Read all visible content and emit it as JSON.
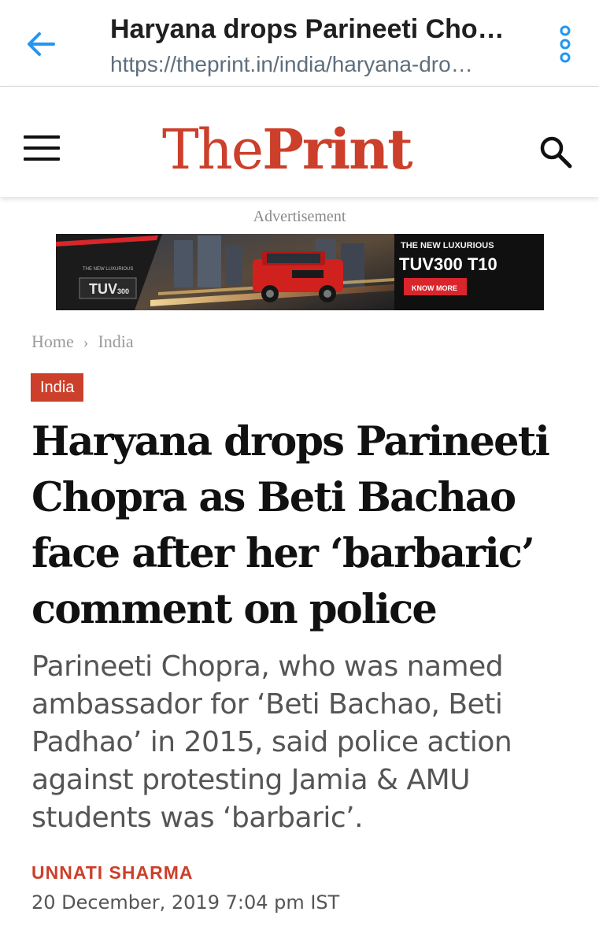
{
  "browser": {
    "title": "Haryana drops Parineeti Cho…",
    "url": "https://theprint.in/india/haryana-dro…",
    "accent_color": "#2196f3"
  },
  "site": {
    "logo_the": "The",
    "logo_print": "Print",
    "brand_color": "#cc3f2a"
  },
  "ad": {
    "label": "Advertisement",
    "brand_small": "THE NEW LUXURIOUS",
    "logo_text": "TUV",
    "logo_suffix": "300",
    "headline_small": "THE NEW LUXURIOUS",
    "headline_big": "TUV300 T10",
    "cta": "KNOW MORE"
  },
  "breadcrumb": {
    "home": "Home",
    "separator": "›",
    "section": "India"
  },
  "article": {
    "category": "India",
    "headline": "Haryana drops Parineeti Chopra as Beti Bachao face after her ‘barbaric’ comment on police",
    "summary": "Parineeti Chopra, who was named ambassador for ‘Beti Bachao, Beti Padhao’ in 2015, said police action against protesting Jamia & AMU students was ‘barbaric’.",
    "author": "UNNATI SHARMA",
    "date": "20 December, 2019 7:04 pm IST"
  }
}
